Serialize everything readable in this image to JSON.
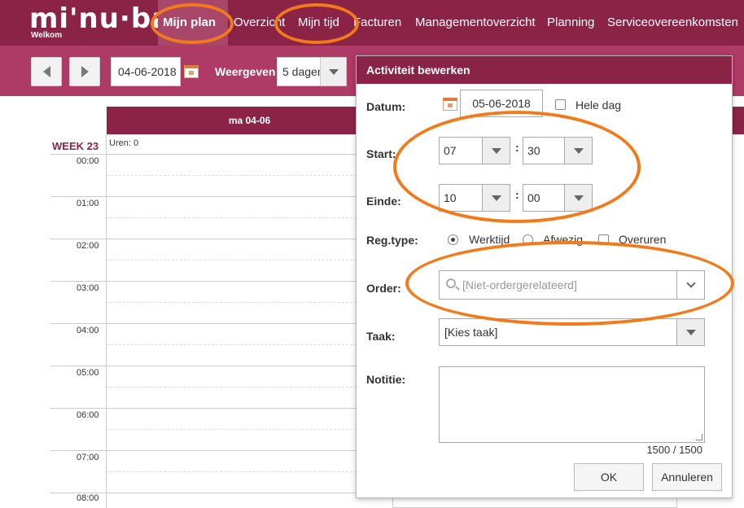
{
  "app": {
    "logo": "mi'nu·ba",
    "logo_sub": "Welkom"
  },
  "nav": {
    "items": [
      {
        "label": "Mijn plan",
        "active": true
      },
      {
        "label": "Overzicht"
      },
      {
        "label": "Mijn tijd"
      },
      {
        "label": "Facturen"
      },
      {
        "label": "Managementoverzicht"
      },
      {
        "label": "Planning"
      },
      {
        "label": "Serviceovereenkomsten"
      }
    ]
  },
  "toolbar": {
    "prev_icon": "triangle-left",
    "next_icon": "triangle-right",
    "date": "04-06-2018",
    "view_label": "Weergeven",
    "view_value": "5 dagen"
  },
  "calendar": {
    "day_header": "ma 04-06",
    "week_label": "WEEK 23",
    "hours_label": "Uren: 0",
    "hours": [
      "00:00",
      "01:00",
      "02:00",
      "03:00",
      "04:00",
      "05:00",
      "06:00",
      "07:00",
      "08:00"
    ]
  },
  "dialog": {
    "title": "Activiteit bewerken",
    "date_label": "Datum:",
    "date_value": "05-06-2018",
    "allday_label": "Hele dag",
    "start_label": "Start:",
    "start_hour": "07",
    "start_min": "30",
    "end_label": "Einde:",
    "end_hour": "10",
    "end_min": "00",
    "colon": ":",
    "regtype_label": "Reg.type:",
    "regtype_options": [
      "Werktijd",
      "Afwezig",
      "Overuren"
    ],
    "regtype_selected": "Werktijd",
    "order_label": "Order:",
    "order_placeholder": "[Niet-ordergerelateerd]",
    "task_label": "Taak:",
    "task_value": "[Kies taak]",
    "note_label": "Notitie:",
    "note_counter": "1500 / 1500",
    "ok_label": "OK",
    "cancel_label": "Annuleren"
  },
  "colors": {
    "brand": "#8b2346",
    "toolbar": "#ae3a66",
    "highlight_ring": "#f27a1a"
  }
}
